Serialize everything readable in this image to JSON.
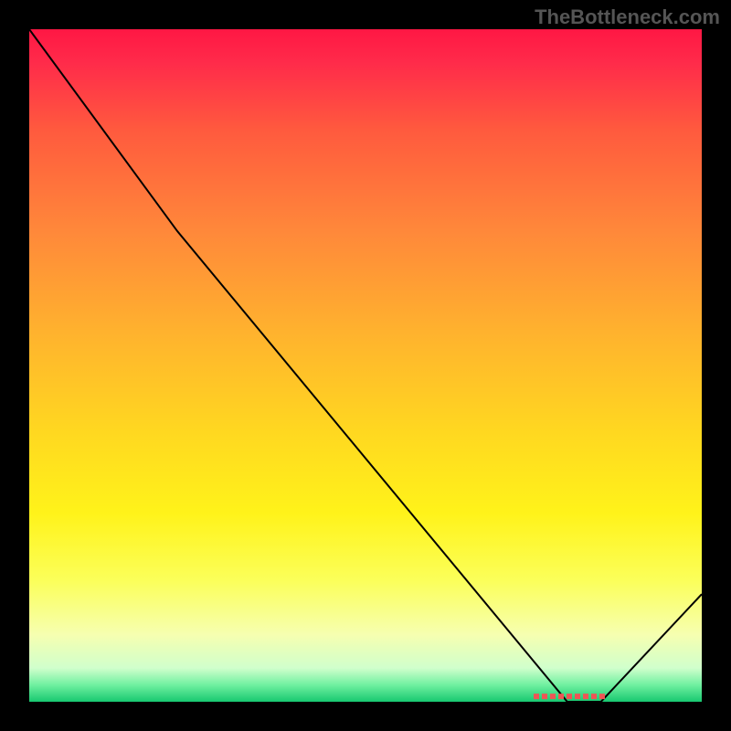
{
  "watermark": "TheBottleneck.com",
  "chart_data": {
    "type": "line",
    "title": "",
    "xlabel": "",
    "ylabel": "",
    "xlim": [
      0,
      100
    ],
    "ylim": [
      0,
      100
    ],
    "series": [
      {
        "name": "bottleneck-curve",
        "x": [
          0,
          22,
          80,
          85,
          100
        ],
        "y": [
          100,
          70,
          0,
          0,
          16
        ]
      }
    ],
    "annotations": [
      {
        "name": "optimal-range-marker",
        "x_start": 75,
        "x_end": 86,
        "y": 0.8,
        "color": "#ee5555"
      }
    ],
    "background_gradient": {
      "stops": [
        {
          "offset": 0.0,
          "color": "#ff1744"
        },
        {
          "offset": 0.05,
          "color": "#ff2b4a"
        },
        {
          "offset": 0.15,
          "color": "#ff5a3e"
        },
        {
          "offset": 0.3,
          "color": "#ff883a"
        },
        {
          "offset": 0.45,
          "color": "#ffb22e"
        },
        {
          "offset": 0.6,
          "color": "#ffd820"
        },
        {
          "offset": 0.72,
          "color": "#fff31a"
        },
        {
          "offset": 0.82,
          "color": "#fbff5a"
        },
        {
          "offset": 0.9,
          "color": "#f6ffb0"
        },
        {
          "offset": 0.95,
          "color": "#d0ffcc"
        },
        {
          "offset": 0.975,
          "color": "#70f0a0"
        },
        {
          "offset": 1.0,
          "color": "#18c870"
        }
      ]
    }
  }
}
